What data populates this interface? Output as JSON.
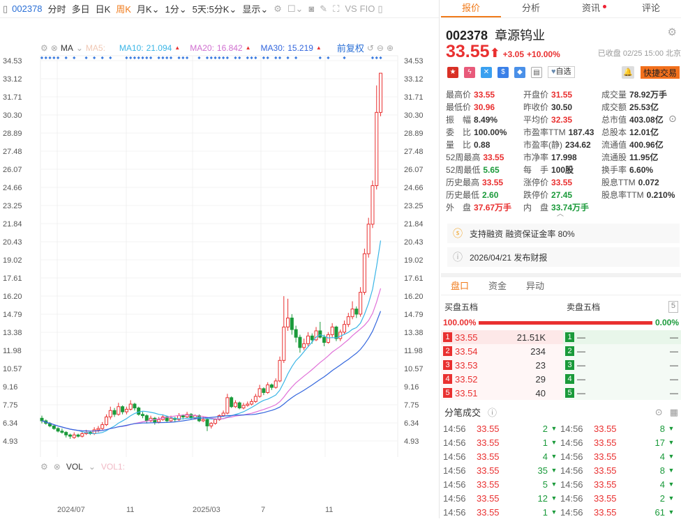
{
  "toolbar": {
    "code": "002378",
    "items": [
      "分时",
      "多日",
      "日K",
      "周K",
      "月K",
      "1分",
      "5天",
      "5分K",
      "显示"
    ],
    "active": "周K",
    "vs": "VS",
    "f10": "FIO"
  },
  "ma": {
    "label": "MA",
    "ma5": "MA5:",
    "ma10_label": "MA10:",
    "ma10": "21.094",
    "ma20_label": "MA20:",
    "ma20": "16.842",
    "ma30_label": "MA30:",
    "ma30": "15.219",
    "adjust": "前复权",
    "colors": {
      "ma10": "#3ab5e6",
      "ma20": "#e070d8",
      "ma30": "#3366dd"
    }
  },
  "vol": {
    "label": "VOL",
    "vol1": "VOL1:"
  },
  "chart_data": {
    "type": "candlestick",
    "period": "weekly",
    "ylim": [
      4.93,
      34.53
    ],
    "y_ticks": [
      "34.53",
      "33.12",
      "31.71",
      "30.30",
      "28.89",
      "27.48",
      "26.07",
      "24.66",
      "23.25",
      "21.84",
      "20.43",
      "19.02",
      "17.61",
      "16.20",
      "14.79",
      "13.38",
      "11.98",
      "10.57",
      "9.16",
      "7.75",
      "6.34",
      "4.93"
    ],
    "x_ticks": [
      {
        "label": "2024/07",
        "index": 4
      },
      {
        "label": "11",
        "index": 21
      },
      {
        "label": "2025/03",
        "index": 38
      },
      {
        "label": "7",
        "index": 55
      },
      {
        "label": "11",
        "index": 71
      }
    ],
    "candles_ohlc": [
      [
        6.7,
        6.9,
        6.3,
        6.5
      ],
      [
        6.5,
        6.6,
        6.2,
        6.3
      ],
      [
        6.3,
        6.4,
        6.0,
        6.1
      ],
      [
        6.1,
        6.2,
        5.8,
        5.9
      ],
      [
        5.9,
        6.0,
        5.6,
        5.7
      ],
      [
        5.7,
        5.9,
        5.5,
        5.6
      ],
      [
        5.6,
        5.7,
        5.2,
        5.4
      ],
      [
        5.4,
        5.5,
        5.1,
        5.3
      ],
      [
        5.2,
        5.6,
        5.1,
        5.4
      ],
      [
        5.4,
        5.5,
        5.2,
        5.3
      ],
      [
        5.3,
        5.7,
        5.2,
        5.5
      ],
      [
        5.5,
        5.8,
        5.4,
        5.6
      ],
      [
        5.6,
        5.7,
        5.4,
        5.5
      ],
      [
        5.5,
        6.0,
        5.4,
        5.8
      ],
      [
        5.8,
        6.1,
        5.6,
        5.9
      ],
      [
        5.9,
        6.4,
        5.8,
        6.2
      ],
      [
        6.2,
        7.0,
        6.1,
        6.8
      ],
      [
        6.8,
        7.6,
        6.6,
        7.3
      ],
      [
        7.3,
        7.5,
        6.8,
        7.0
      ],
      [
        7.0,
        7.9,
        6.9,
        7.6
      ],
      [
        7.6,
        7.7,
        7.0,
        7.2
      ],
      [
        7.2,
        7.6,
        7.0,
        7.4
      ],
      [
        7.4,
        8.1,
        7.3,
        7.8
      ],
      [
        7.8,
        7.9,
        7.3,
        7.5
      ],
      [
        7.5,
        7.6,
        6.9,
        7.0
      ],
      [
        7.0,
        7.2,
        6.7,
        6.9
      ],
      [
        6.9,
        7.0,
        6.3,
        6.5
      ],
      [
        6.5,
        6.9,
        6.4,
        6.7
      ],
      [
        6.7,
        6.8,
        6.2,
        6.4
      ],
      [
        6.4,
        6.8,
        6.3,
        6.6
      ],
      [
        6.6,
        7.0,
        6.5,
        6.8
      ],
      [
        6.8,
        6.9,
        6.4,
        6.5
      ],
      [
        6.5,
        6.9,
        6.4,
        6.7
      ],
      [
        6.7,
        6.8,
        6.4,
        6.6
      ],
      [
        6.6,
        7.1,
        6.5,
        6.9
      ],
      [
        6.9,
        7.0,
        6.6,
        6.8
      ],
      [
        6.8,
        7.2,
        6.7,
        7.0
      ],
      [
        7.0,
        7.1,
        6.6,
        6.7
      ],
      [
        6.7,
        7.0,
        6.6,
        6.9
      ],
      [
        6.9,
        7.0,
        6.4,
        6.5
      ],
      [
        6.5,
        6.8,
        6.4,
        6.6
      ],
      [
        6.6,
        6.7,
        5.7,
        6.1
      ],
      [
        6.1,
        6.4,
        5.9,
        6.3
      ],
      [
        6.3,
        6.7,
        6.2,
        6.6
      ],
      [
        6.6,
        7.0,
        6.5,
        6.9
      ],
      [
        6.9,
        7.3,
        6.8,
        7.1
      ],
      [
        7.1,
        8.6,
        7.0,
        8.3
      ],
      [
        8.3,
        8.4,
        7.5,
        7.6
      ],
      [
        7.6,
        8.1,
        7.5,
        7.9
      ],
      [
        7.9,
        8.0,
        7.4,
        7.5
      ],
      [
        7.5,
        7.9,
        7.4,
        7.7
      ],
      [
        7.7,
        8.0,
        7.6,
        7.8
      ],
      [
        7.8,
        8.2,
        7.7,
        8.0
      ],
      [
        8.0,
        8.6,
        7.9,
        8.4
      ],
      [
        8.4,
        9.3,
        8.3,
        9.0
      ],
      [
        9.0,
        9.1,
        8.5,
        8.7
      ],
      [
        8.7,
        9.5,
        8.6,
        9.3
      ],
      [
        9.3,
        9.4,
        8.9,
        9.1
      ],
      [
        9.1,
        9.8,
        9.0,
        9.6
      ],
      [
        9.6,
        11.5,
        9.5,
        11.2
      ],
      [
        11.2,
        16.2,
        11.0,
        13.8
      ],
      [
        13.8,
        16.0,
        13.5,
        14.5
      ],
      [
        14.5,
        14.8,
        13.2,
        13.6
      ],
      [
        13.6,
        13.9,
        12.6,
        13.0
      ],
      [
        13.0,
        13.2,
        11.8,
        12.2
      ],
      [
        12.2,
        12.9,
        12.0,
        12.5
      ],
      [
        12.5,
        13.4,
        12.3,
        13.1
      ],
      [
        13.1,
        13.3,
        12.5,
        12.8
      ],
      [
        12.8,
        13.8,
        12.7,
        13.5
      ],
      [
        13.5,
        14.2,
        12.9,
        13.0
      ],
      [
        13.0,
        13.2,
        12.3,
        12.6
      ],
      [
        12.6,
        13.4,
        12.5,
        13.2
      ],
      [
        13.2,
        14.1,
        13.0,
        13.8
      ],
      [
        13.8,
        13.9,
        12.7,
        12.9
      ],
      [
        12.9,
        13.6,
        12.7,
        13.4
      ],
      [
        13.4,
        14.3,
        13.2,
        14.0
      ],
      [
        14.0,
        14.9,
        13.8,
        14.6
      ],
      [
        14.6,
        15.8,
        14.4,
        15.2
      ],
      [
        15.2,
        15.4,
        14.5,
        14.8
      ],
      [
        14.8,
        16.9,
        14.6,
        16.5
      ],
      [
        16.5,
        19.9,
        16.3,
        19.5
      ],
      [
        19.5,
        22.3,
        19.2,
        21.8
      ],
      [
        21.8,
        25.2,
        21.5,
        24.8
      ],
      [
        24.8,
        32.6,
        24.5,
        30.5
      ],
      [
        30.5,
        33.55,
        30.2,
        33.55
      ]
    ],
    "colors": {
      "up": "#e93030",
      "down": "#1a9a3a",
      "marker": "#3a7be0"
    }
  },
  "right": {
    "tabs": [
      "报价",
      "分析",
      "资讯",
      "评论"
    ],
    "active_tab": 0,
    "code": "002378",
    "name": "章源钨业",
    "price": "33.55",
    "arrow": "⬆",
    "change": "+3.05",
    "change_pct": "+10.00%",
    "status": "已收盘 02/25 15:00 北京",
    "fav": "自选",
    "quick_trade": "快捷交易",
    "stats": [
      [
        {
          "l": "最高价",
          "v": "33.55",
          "c": "red"
        },
        {
          "l": "开盘价",
          "v": "31.55",
          "c": "red"
        },
        {
          "l": "成交量",
          "v": "78.92万手",
          "c": ""
        }
      ],
      [
        {
          "l": "最低价",
          "v": "30.96",
          "c": "red"
        },
        {
          "l": "昨收价",
          "v": "30.50",
          "c": ""
        },
        {
          "l": "成交额",
          "v": "25.53亿",
          "c": ""
        }
      ],
      [
        {
          "l": "振　幅",
          "v": "8.49%",
          "c": ""
        },
        {
          "l": "平均价",
          "v": "32.35",
          "c": "red"
        },
        {
          "l": "总市值",
          "v": "403.08亿",
          "c": ""
        }
      ],
      [
        {
          "l": "委　比",
          "v": "100.00%",
          "c": ""
        },
        {
          "l": "市盈率TTM",
          "v": "187.43",
          "c": ""
        },
        {
          "l": "总股本",
          "v": "12.01亿",
          "c": ""
        }
      ],
      [
        {
          "l": "量　比",
          "v": "0.88",
          "c": ""
        },
        {
          "l": "市盈率(静)",
          "v": "234.62",
          "c": ""
        },
        {
          "l": "流通值",
          "v": "400.96亿",
          "c": ""
        }
      ],
      [
        {
          "l": "52周最高",
          "v": "33.55",
          "c": "red"
        },
        {
          "l": "市净率",
          "v": "17.998",
          "c": ""
        },
        {
          "l": "流通股",
          "v": "11.95亿",
          "c": ""
        }
      ],
      [
        {
          "l": "52周最低",
          "v": "5.65",
          "c": "green"
        },
        {
          "l": "每　手",
          "v": "100股",
          "c": ""
        },
        {
          "l": "换手率",
          "v": "6.60%",
          "c": ""
        }
      ],
      [
        {
          "l": "历史最高",
          "v": "33.55",
          "c": "red"
        },
        {
          "l": "涨停价",
          "v": "33.55",
          "c": "red"
        },
        {
          "l": "股息TTM",
          "v": "0.072",
          "c": ""
        }
      ],
      [
        {
          "l": "历史最低",
          "v": "2.60",
          "c": "green"
        },
        {
          "l": "跌停价",
          "v": "27.45",
          "c": "green"
        },
        {
          "l": "股息率TTM",
          "v": "0.210%",
          "c": ""
        }
      ],
      [
        {
          "l": "外　盘",
          "v": "37.67万手",
          "c": "red"
        },
        {
          "l": "内　盘",
          "v": "33.74万手",
          "c": "green"
        }
      ]
    ],
    "margin_info": "支持融资 融资保证金率 80%",
    "report_info": "2026/04/21  发布财报",
    "subtabs": [
      "盘口",
      "资金",
      "异动"
    ],
    "orderbook": {
      "buy_title": "买盘五档",
      "sell_title": "卖盘五档",
      "depth": "5",
      "buy_pct": "100.00%",
      "sell_pct": "0.00%",
      "buy_ratio": 1.0,
      "bids": [
        {
          "n": "1",
          "p": "33.55",
          "q": "21.51K"
        },
        {
          "n": "2",
          "p": "33.54",
          "q": "234"
        },
        {
          "n": "3",
          "p": "33.53",
          "q": "23"
        },
        {
          "n": "4",
          "p": "33.52",
          "q": "29"
        },
        {
          "n": "5",
          "p": "33.51",
          "q": "40"
        }
      ],
      "asks": [
        {
          "n": "1",
          "p": "—",
          "q": "—"
        },
        {
          "n": "2",
          "p": "—",
          "q": "—"
        },
        {
          "n": "3",
          "p": "—",
          "q": "—"
        },
        {
          "n": "4",
          "p": "—",
          "q": "—"
        },
        {
          "n": "5",
          "p": "—",
          "q": "—"
        }
      ]
    },
    "trades_title": "分笔成交",
    "trades": [
      [
        {
          "t": "14:56",
          "p": "33.55",
          "q": "2"
        },
        {
          "t": "14:56",
          "p": "33.55",
          "q": "8"
        }
      ],
      [
        {
          "t": "14:56",
          "p": "33.55",
          "q": "1"
        },
        {
          "t": "14:56",
          "p": "33.55",
          "q": "17"
        }
      ],
      [
        {
          "t": "14:56",
          "p": "33.55",
          "q": "4"
        },
        {
          "t": "14:56",
          "p": "33.55",
          "q": "4"
        }
      ],
      [
        {
          "t": "14:56",
          "p": "33.55",
          "q": "35"
        },
        {
          "t": "14:56",
          "p": "33.55",
          "q": "8"
        }
      ],
      [
        {
          "t": "14:56",
          "p": "33.55",
          "q": "5"
        },
        {
          "t": "14:56",
          "p": "33.55",
          "q": "4"
        }
      ],
      [
        {
          "t": "14:56",
          "p": "33.55",
          "q": "12"
        },
        {
          "t": "14:56",
          "p": "33.55",
          "q": "2"
        }
      ],
      [
        {
          "t": "14:56",
          "p": "33.55",
          "q": "1"
        },
        {
          "t": "14:56",
          "p": "33.55",
          "q": "61"
        }
      ]
    ]
  }
}
